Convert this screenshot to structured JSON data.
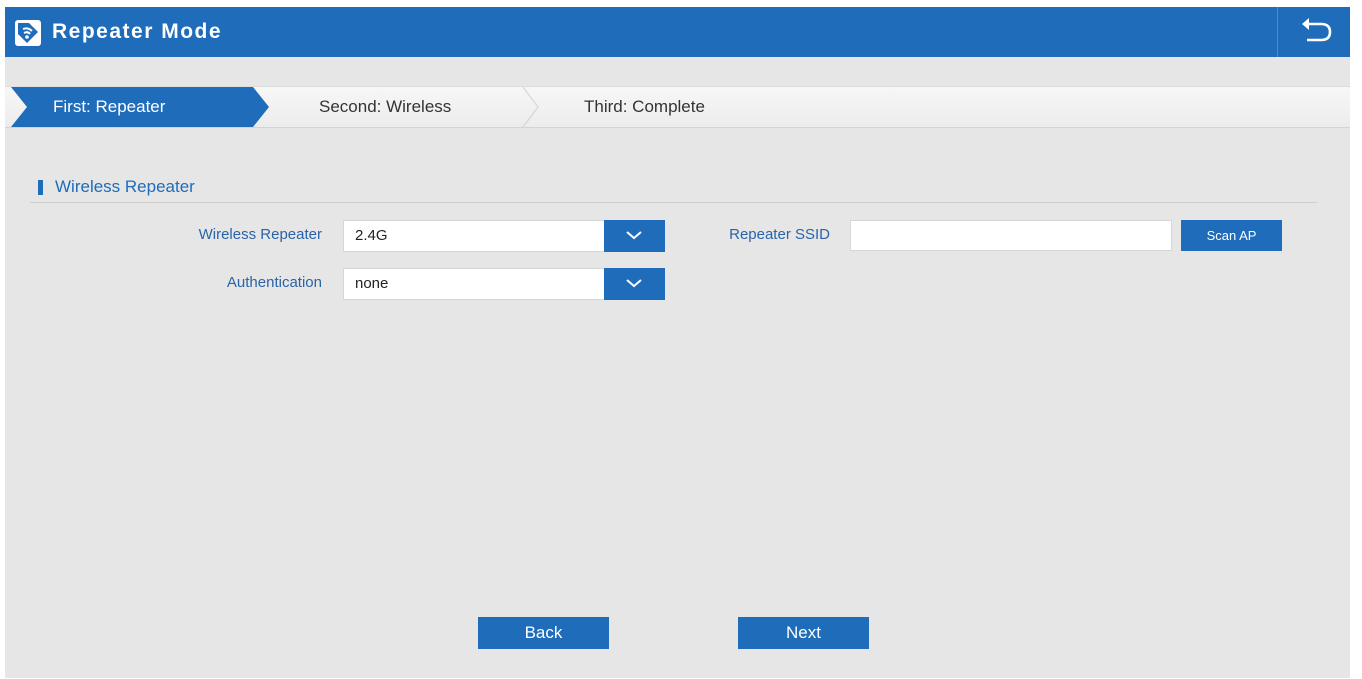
{
  "header": {
    "title": "Repeater Mode",
    "logo_icon": "wifi-settings-icon",
    "back_icon": "return-icon"
  },
  "steps": [
    {
      "label": "First: Repeater",
      "active": true
    },
    {
      "label": "Second: Wireless",
      "active": false
    },
    {
      "label": "Third: Complete",
      "active": false
    }
  ],
  "section": {
    "title": "Wireless Repeater"
  },
  "form": {
    "wireless_repeater": {
      "label": "Wireless Repeater",
      "value": "2.4G"
    },
    "authentication": {
      "label": "Authentication",
      "value": "none"
    },
    "repeater_ssid": {
      "label": "Repeater SSID",
      "value": "",
      "placeholder": ""
    },
    "scan_button": "Scan AP"
  },
  "footer": {
    "back_label": "Back",
    "next_label": "Next"
  },
  "colors": {
    "accent": "#1e6cba",
    "label_text": "#2a63a8",
    "background": "#e6e6e6"
  }
}
